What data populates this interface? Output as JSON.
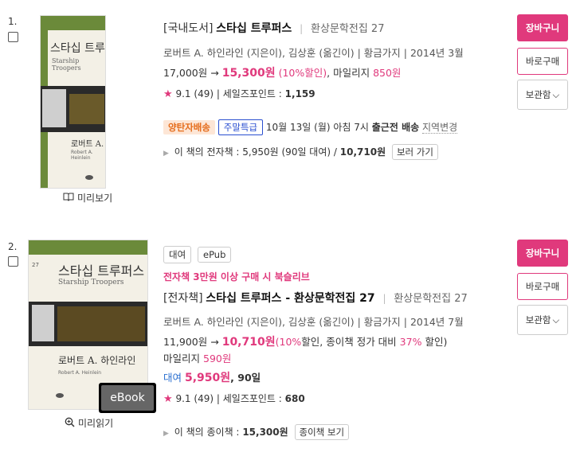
{
  "items": [
    {
      "num": "1.",
      "cover": {
        "title": "스타십 트루퍼스",
        "subtitle": "Starship Troopers",
        "author": "로버트 A. 하인라인",
        "author_en": "Robert A. Heinlein"
      },
      "preview_label": "미리보기",
      "category": "[국내도서]",
      "title": "스타십 트루퍼스",
      "series": "환상문학전집 27",
      "author_line": "로버트 A. 하인라인 (지은이), 김상훈 (옮긴이) | 황금가지 | 2014년 3월",
      "list_price": "17,000원",
      "arrow": "→",
      "sale_price": "15,300원",
      "discount": "(10%할인)",
      "mileage_label": ", 마일리지",
      "mileage": "850원",
      "rating": "9.1",
      "reviews": "(49)",
      "sales_point_label": "| 세일즈포인트 :",
      "sales_point": "1,159",
      "delivery_tag": "양탄자배송",
      "delivery_tag2": "주말특급",
      "delivery_text": "10월 13일 (월) 아침 7시",
      "delivery_bold": "출근전 배송",
      "region_change": "지역변경",
      "ebook_prefix": "이 책의 전자책 : 5,950원 (90일 대여) /",
      "ebook_price": "10,710원",
      "ebook_btn": "보러 가기",
      "buttons": {
        "cart": "장바구니",
        "buy": "바로구매",
        "keep": "보관함"
      }
    },
    {
      "num": "2.",
      "cover": {
        "title": "스타십 트루퍼스",
        "subtitle": "Starship Troopers",
        "author": "로버트 A. 하인라인",
        "author_en": "Robert A. Heinlein",
        "vol": "27"
      },
      "ebook_badge": "eBook",
      "preview_label": "미리읽기",
      "formats": [
        "대여",
        "ePub"
      ],
      "promo": "전자책 3만원 이상 구매 시 북슬리브",
      "category": "[전자책]",
      "title": "스타십 트루퍼스 - 환상문학전집 27",
      "series": "환상문학전집 27",
      "author_line": "로버트 A. 하인라인 (지은이), 김상훈 (옮긴이) | 황금가지 | 2014년 7월",
      "list_price": "11,900원",
      "arrow": "→",
      "sale_price": "10,710원",
      "discount_a": "(10%",
      "discount_b": "할인, 종이책 정가 대비",
      "discount_c": "37%",
      "discount_d": "할인)",
      "mileage_label": "마일리지",
      "mileage": "590원",
      "rental_label": "대여",
      "rental_price": "5,950원",
      "rental_days": ", 90일",
      "rating": "9.1",
      "reviews": "(49)",
      "sales_point_label": "| 세일즈포인트 :",
      "sales_point": "680",
      "paper_prefix": "이 책의 종이책 :",
      "paper_price": "15,300원",
      "paper_btn": "종이책 보기",
      "buttons": {
        "cart": "장바구니",
        "buy": "바로구매",
        "keep": "보관함"
      }
    }
  ]
}
